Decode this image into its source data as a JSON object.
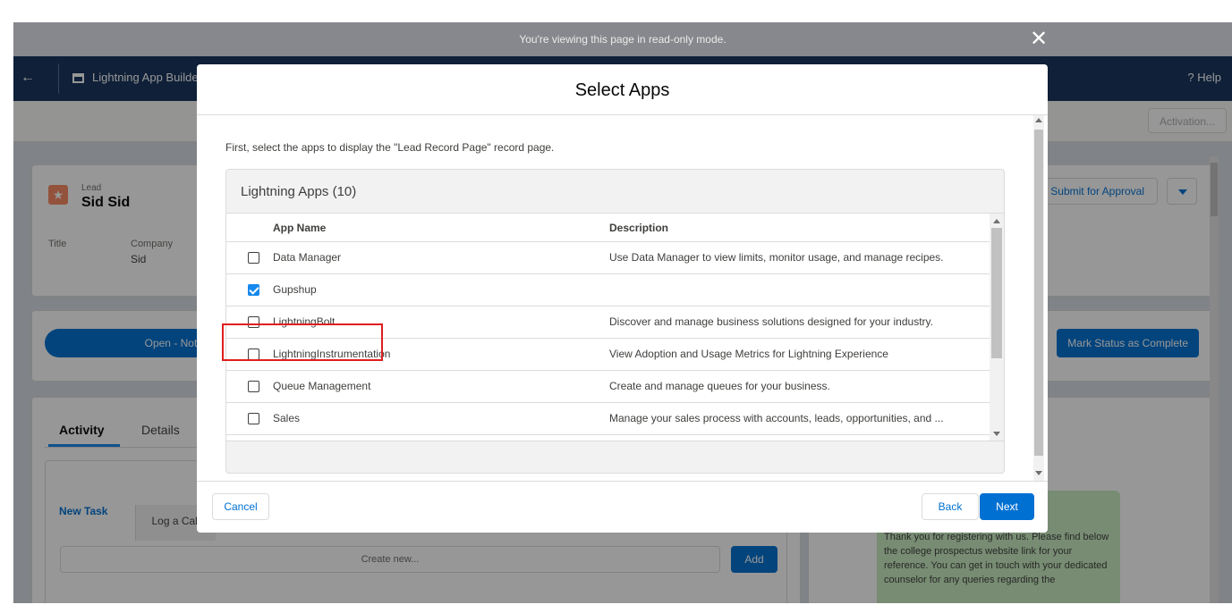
{
  "banner": {
    "text": "You're viewing this page in read-only mode."
  },
  "builder": {
    "app_name": "Lightning App Builder",
    "help_label": "Help",
    "activation_label": "Activation..."
  },
  "record": {
    "object_label": "Lead",
    "name": "Sid Sid",
    "fields": [
      {
        "label": "Title",
        "value": ""
      },
      {
        "label": "Company",
        "value": "Sid"
      }
    ],
    "submit_label": "Submit for Approval",
    "path_stage": "Open - Not Contacted",
    "mark_complete_label": "Mark Status as Complete",
    "tabs": [
      "Activity",
      "Details"
    ],
    "activity_actions": [
      "New Task",
      "Log a Call"
    ],
    "create_new_placeholder": "Create new...",
    "add_label": "Add",
    "side_message": "Thank you for registering with us. Please find below the college prospectus website link for your reference. You can get in touch with your dedicated counselor for any queries regarding the"
  },
  "modal": {
    "title": "Select Apps",
    "intro": "First, select the apps to display the \"Lead Record Page\" record page.",
    "apps_section_title": "Lightning Apps (10)",
    "columns": {
      "name": "App Name",
      "description": "Description"
    },
    "rows": [
      {
        "name": "Data Manager",
        "description": "Use Data Manager to view limits, monitor usage, and manage recipes.",
        "checked": false
      },
      {
        "name": "Gupshup",
        "description": "",
        "checked": true
      },
      {
        "name": "LightningBolt",
        "description": "Discover and manage business solutions designed for your industry.",
        "checked": false
      },
      {
        "name": "LightningInstrumentation",
        "description": "View Adoption and Usage Metrics for Lightning Experience",
        "checked": false
      },
      {
        "name": "Queue Management",
        "description": "Create and manage queues for your business.",
        "checked": false
      },
      {
        "name": "Sales",
        "description": "Manage your sales process with accounts, leads, opportunities, and ...",
        "checked": false
      }
    ],
    "footer": {
      "cancel": "Cancel",
      "back": "Back",
      "next": "Next"
    }
  },
  "colors": {
    "brand_blue": "#0070d2",
    "header_navy": "#16325c",
    "highlight_red": "#e01e1e",
    "lead_orange": "#f88962"
  }
}
